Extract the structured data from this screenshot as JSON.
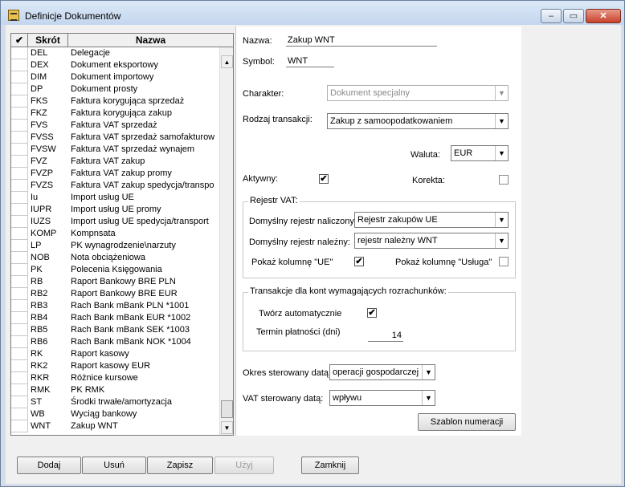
{
  "window": {
    "title": "Definicje Dokumentów",
    "minimize_label": "–",
    "maximize_label": "▭",
    "close_label": "✕"
  },
  "list": {
    "headers": {
      "check": "✔",
      "code": "Skrót",
      "name": "Nazwa"
    },
    "rows": [
      {
        "code": "DEL",
        "name": "Delegacje"
      },
      {
        "code": "DEX",
        "name": "Dokument eksportowy"
      },
      {
        "code": "DIM",
        "name": "Dokument importowy"
      },
      {
        "code": "DP",
        "name": "Dokument prosty"
      },
      {
        "code": "FKS",
        "name": "Faktura korygująca sprzedaż"
      },
      {
        "code": "FKZ",
        "name": "Faktura korygująca zakup"
      },
      {
        "code": "FVS",
        "name": "Faktura VAT sprzedaż"
      },
      {
        "code": "FVSS",
        "name": "Faktura VAT sprzedaż samofakturow"
      },
      {
        "code": "FVSW",
        "name": "Faktura VAT sprzedaż wynajem"
      },
      {
        "code": "FVZ",
        "name": "Faktura VAT zakup"
      },
      {
        "code": "FVZP",
        "name": "Faktura VAT zakup promy"
      },
      {
        "code": "FVZS",
        "name": "Faktura VAT zakup spedycja/transpo"
      },
      {
        "code": "Iu",
        "name": "Import usług UE"
      },
      {
        "code": "IUPR",
        "name": "Import usług UE promy"
      },
      {
        "code": "IUZS",
        "name": "Import usług UE spedycja/transport"
      },
      {
        "code": "KOMP",
        "name": "Kompnsata"
      },
      {
        "code": "LP",
        "name": "PK wynagrodzenie\\narzuty"
      },
      {
        "code": "NOB",
        "name": "Nota obciążeniowa"
      },
      {
        "code": "PK",
        "name": "Polecenia Księgowania"
      },
      {
        "code": "RB",
        "name": "Raport Bankowy BRE PLN"
      },
      {
        "code": "RB2",
        "name": "Raport Bankowy BRE EUR"
      },
      {
        "code": "RB3",
        "name": "Rach Bank mBank PLN *1001"
      },
      {
        "code": "RB4",
        "name": "Rach Bank mBank EUR *1002"
      },
      {
        "code": "RB5",
        "name": "Rach Bank mBank SEK *1003"
      },
      {
        "code": "RB6",
        "name": "Rach Bank mBank NOK *1004"
      },
      {
        "code": "RK",
        "name": "Raport kasowy"
      },
      {
        "code": "RK2",
        "name": "Raport kasowy EUR"
      },
      {
        "code": "RKR",
        "name": "Różnice kursowe"
      },
      {
        "code": "RMK",
        "name": "PK RMK"
      },
      {
        "code": "ST",
        "name": "Środki trwałe/amortyzacja"
      },
      {
        "code": "WB",
        "name": "Wyciąg bankowy"
      },
      {
        "code": "WNT",
        "name": "Zakup WNT"
      }
    ]
  },
  "form": {
    "name_label": "Nazwa:",
    "name_value": "Zakup WNT",
    "symbol_label": "Symbol:",
    "symbol_value": "WNT",
    "character_label": "Charakter:",
    "character_value": "Dokument specjalny",
    "transaction_label": "Rodzaj transakcji:",
    "transaction_value": "Zakup z samoopodatkowaniem",
    "currency_label": "Waluta:",
    "currency_value": "EUR",
    "active_label": "Aktywny:",
    "active_checked": "✔",
    "correction_label": "Korekta:",
    "vat_group_title": "Rejestr VAT:",
    "input_register_label": "Domyślny rejestr naliczony:",
    "input_register_value": "Rejestr zakupów UE",
    "output_register_label": "Domyślny rejestr należny:",
    "output_register_value": "rejestr należny WNT",
    "show_ue_label": "Pokaż kolumnę \"UE\"",
    "show_ue_checked": "✔",
    "show_service_label": "Pokaż kolumnę \"Usługa\"",
    "settlement_group_title": "Transakcje dla kont wymagających rozrachunków:",
    "auto_create_label": "Twórz automatycznie",
    "auto_create_checked": "✔",
    "payment_term_label": "Termin płatności (dni)",
    "payment_term_value": "14",
    "period_date_label": "Okres sterowany datą:",
    "period_date_value": "operacji gospodarczej",
    "vat_date_label": "VAT sterowany datą:",
    "vat_date_value": "wpływu",
    "numbering_button": "Szablon numeracji"
  },
  "buttons": {
    "add": "Dodaj",
    "delete": "Usuń",
    "save": "Zapisz",
    "use": "Użyj",
    "close": "Zamknij"
  }
}
